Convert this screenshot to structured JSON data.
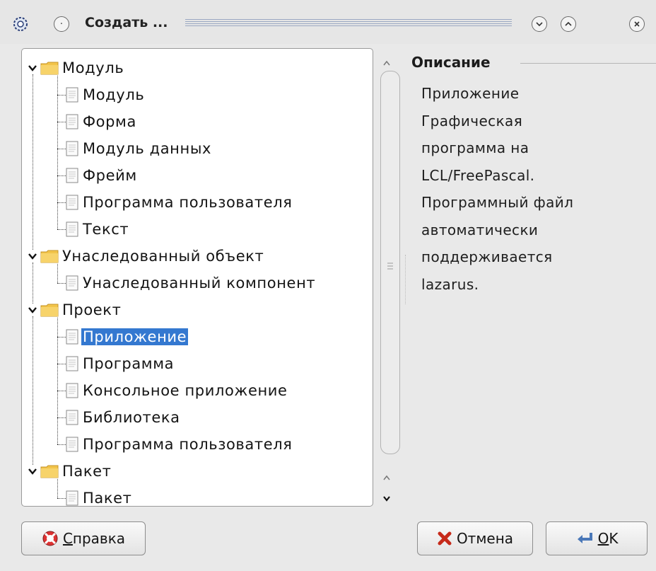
{
  "window": {
    "title": "Создать ...",
    "app_icon": "lazarus-gear-icon",
    "buttons": [
      "minimize-icon",
      "maximize-icon",
      "close-icon"
    ]
  },
  "tree": {
    "groups": [
      {
        "label": "Модуль",
        "items": [
          "Модуль",
          "Форма",
          "Модуль данных",
          "Фрейм",
          "Программа пользователя",
          "Текст"
        ]
      },
      {
        "label": "Унаследованный объект",
        "items": [
          "Унаследованный компонент"
        ]
      },
      {
        "label": "Проект",
        "items": [
          "Приложение",
          "Программа",
          "Консольное приложение",
          "Библиотека",
          "Программа пользователя"
        ]
      },
      {
        "label": "Пакет",
        "items": [
          "Пакет"
        ]
      }
    ],
    "selected": "Приложение"
  },
  "description": {
    "heading": "Описание",
    "lines": [
      "Приложение",
      "Графическая",
      "программа на",
      "LCL/FreePascal.",
      "Программный файл",
      "автоматически",
      "поддерживается",
      "lazarus."
    ]
  },
  "buttons": {
    "help": {
      "accel": "С",
      "rest": "правка"
    },
    "cancel": "Отмена",
    "ok": {
      "accel": "O",
      "rest": "K"
    }
  },
  "colors": {
    "selection": "#3478d0",
    "folder": "#f2c44a"
  }
}
